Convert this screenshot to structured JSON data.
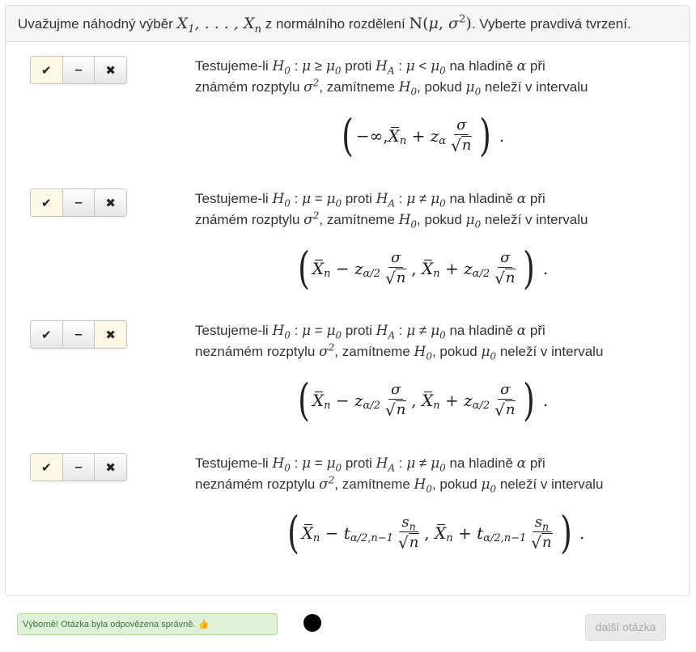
{
  "question": {
    "prefix": "Uvažujme náhodný výběr",
    "middle": "z normálního rozdělení",
    "suffix": ". Vyberte pravdivá tvrzení."
  },
  "options": [
    {
      "state": "correct",
      "text_1": "Testujeme-li",
      "text_2": "proti",
      "text_3": "na hladině",
      "text_4": "při",
      "text_5": "známém rozptylu",
      "text_6": ", zamítneme",
      "text_7": ", pokud",
      "text_8": "neleží v intervalu"
    },
    {
      "state": "correct",
      "text_1": "Testujeme-li",
      "text_2": "proti",
      "text_3": "na hladině",
      "text_4": "při",
      "text_5": "známém rozptylu",
      "text_6": ", zamítneme",
      "text_7": ", pokud",
      "text_8": "neleží v intervalu"
    },
    {
      "state": "wrong",
      "text_1": "Testujeme-li",
      "text_2": "proti",
      "text_3": "na hladině",
      "text_4": "při",
      "text_5": "neznámém rozptylu",
      "text_6": ", zamítneme",
      "text_7": ", pokud",
      "text_8": "neleží v intervalu"
    },
    {
      "state": "correct",
      "text_1": "Testujeme-li",
      "text_2": "proti",
      "text_3": "na hladině",
      "text_4": "při",
      "text_5": "neznámém rozptylu",
      "text_6": ", zamítneme",
      "text_7": ", pokud",
      "text_8": "neleží v intervalu"
    }
  ],
  "buttons": {
    "yes": "✔",
    "neutral": "‒",
    "no": "✖"
  },
  "feedback": {
    "text": "Výborně! Otázka byla odpovězena správně.",
    "icon": "👍"
  },
  "next_button": "další otázka",
  "colors": {
    "active_button": "#fcf8e3",
    "feedback_bg": "#dff0d8",
    "feedback_text": "#3c763d"
  }
}
